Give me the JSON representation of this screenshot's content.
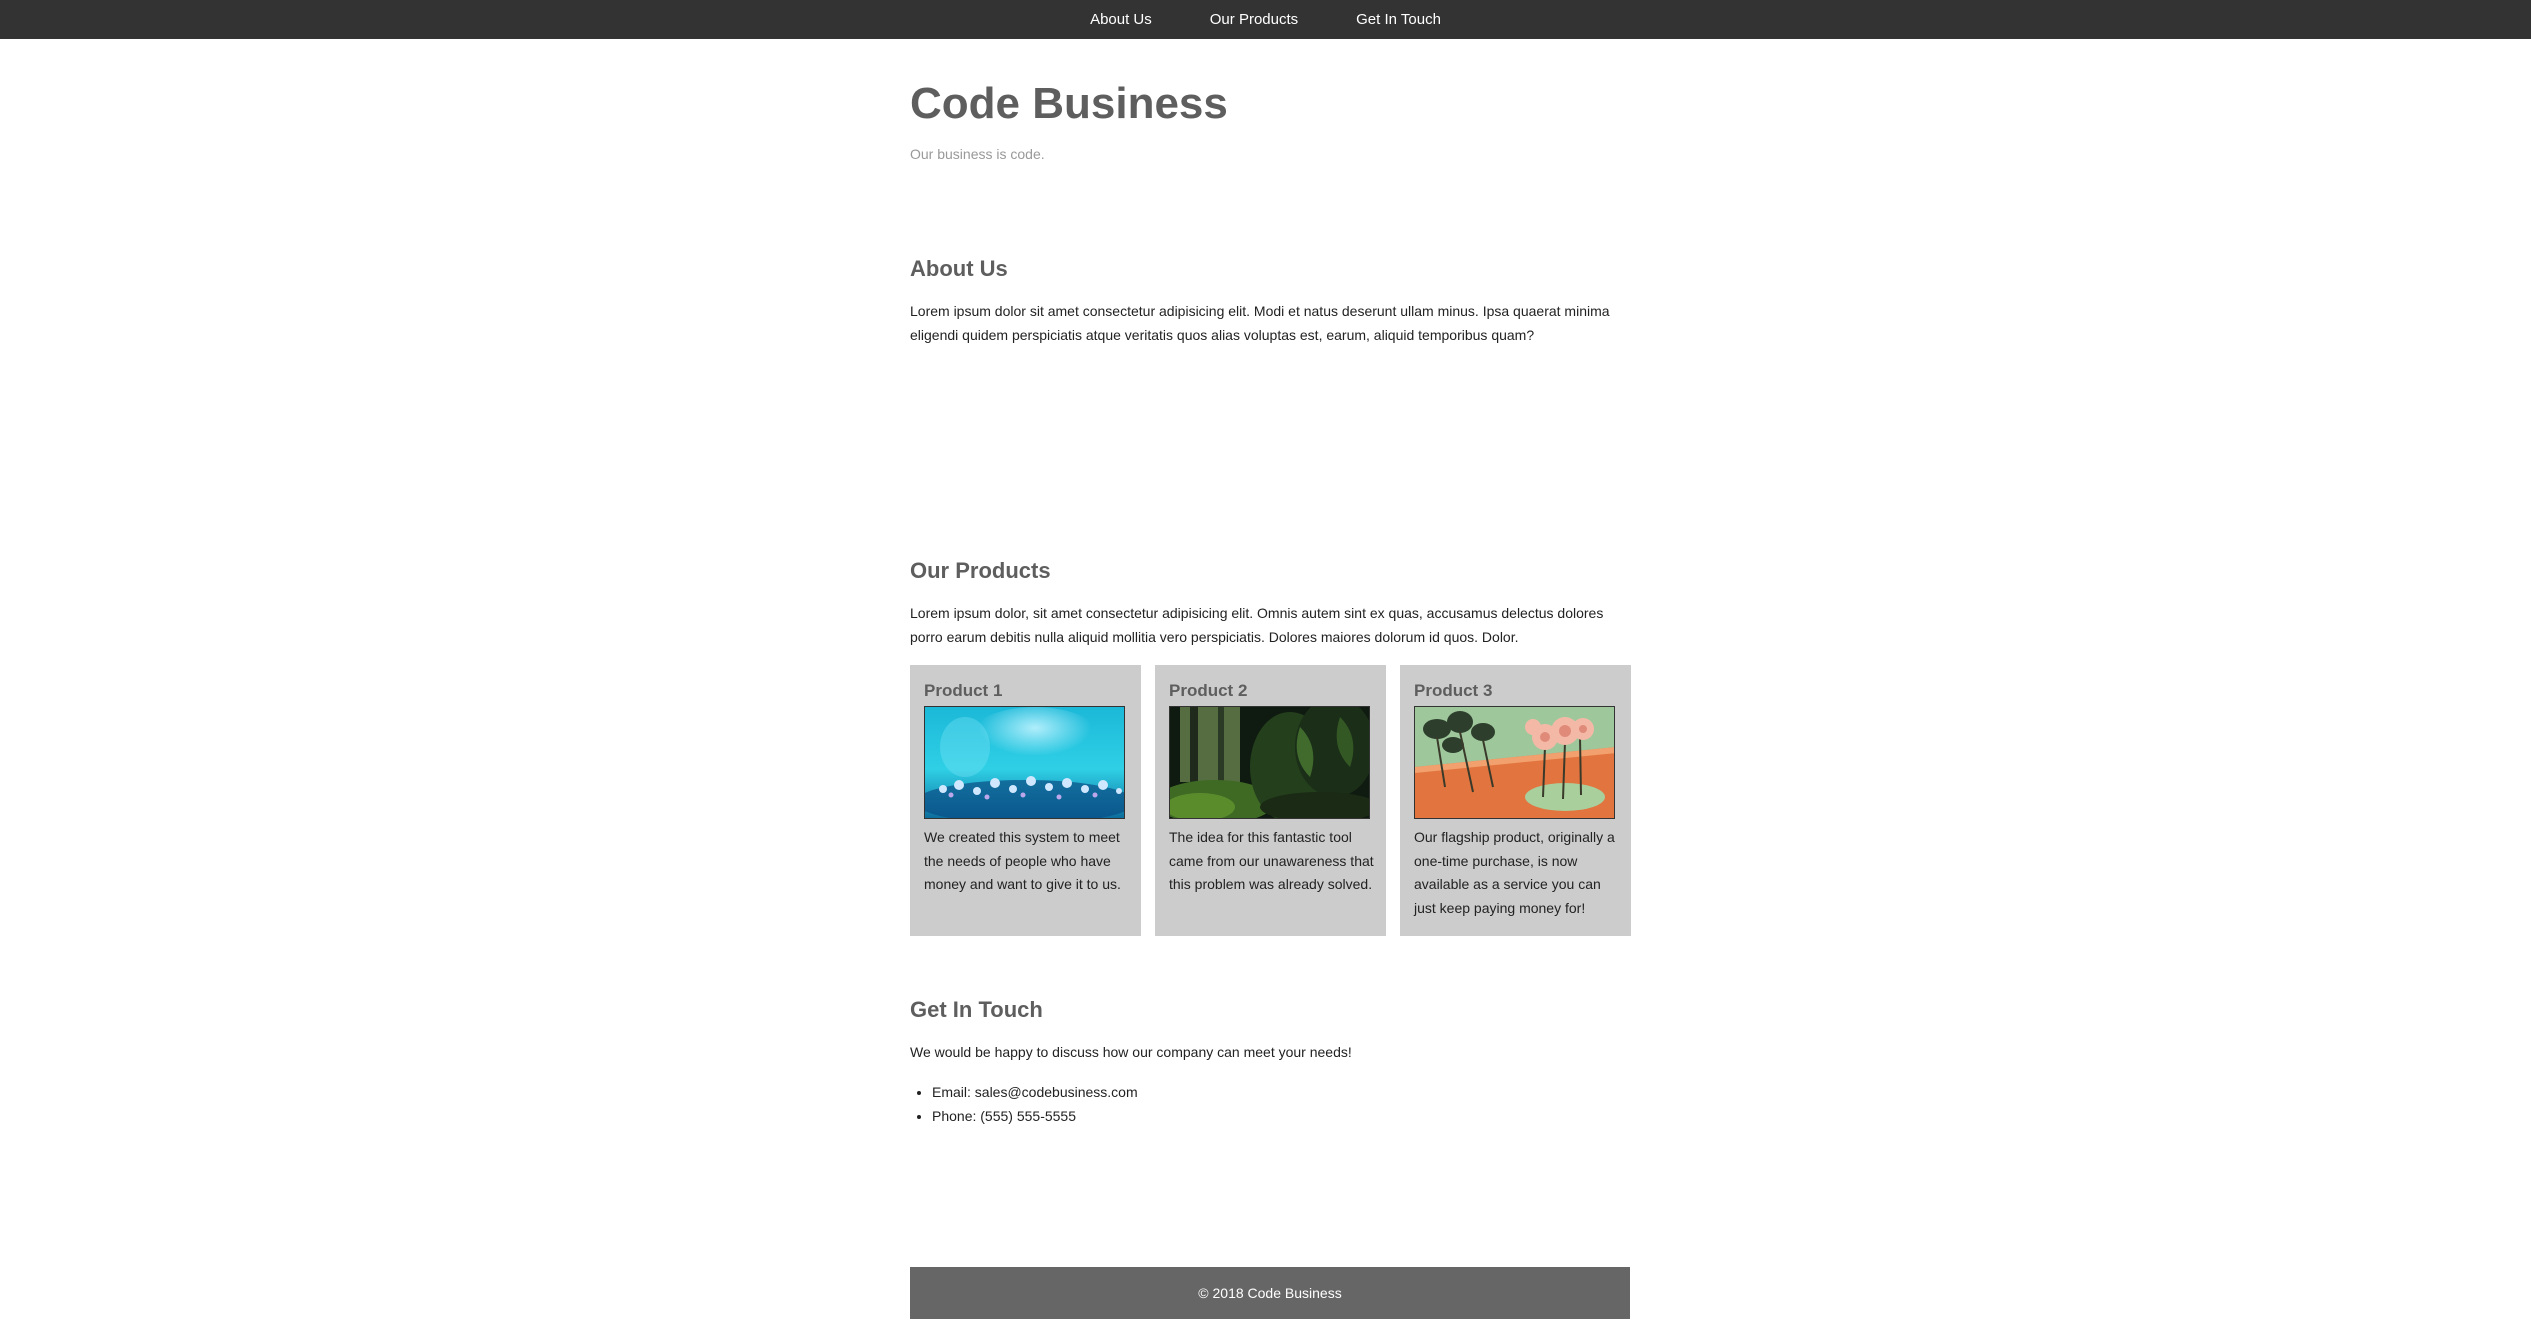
{
  "nav": {
    "items": [
      {
        "label": "About Us"
      },
      {
        "label": "Our Products"
      },
      {
        "label": "Get In Touch"
      }
    ]
  },
  "header": {
    "title": "Code Business",
    "tagline": "Our business is code."
  },
  "about": {
    "title": "About Us",
    "text": "Lorem ipsum dolor sit amet consectetur adipisicing elit. Modi et natus deserunt ullam minus. Ipsa quaerat minima eligendi quidem perspiciatis atque veritatis quos alias voluptas est, earum, aliquid temporibus quam?"
  },
  "products": {
    "title": "Our Products",
    "text": "Lorem ipsum dolor, sit amet consectetur adipisicing elit. Omnis autem sint ex quas, accusamus delectus dolores porro earum debitis nulla aliquid mollitia vero perspiciatis. Dolores maiores dolorum id quos. Dolor.",
    "items": [
      {
        "title": "Product 1",
        "text": "We created this system to meet the needs of people who have money and want to give it to us.",
        "image": "blue-bokeh-flowers-image"
      },
      {
        "title": "Product 2",
        "text": "The idea for this fantastic tool came from our unawareness that this problem was already solved.",
        "image": "green-forest-image"
      },
      {
        "title": "Product 3",
        "text": "Our flagship product, originally a one-time purchase, is now available as a service you can just keep paying money for!",
        "image": "pink-flowers-illustration-image"
      }
    ]
  },
  "contact": {
    "title": "Get In Touch",
    "text": "We would be happy to discuss how our company can meet your needs!",
    "email": "Email: sales@codebusiness.com",
    "phone": "Phone: (555) 555-5555"
  },
  "footer": {
    "text": "© 2018 Code Business"
  }
}
